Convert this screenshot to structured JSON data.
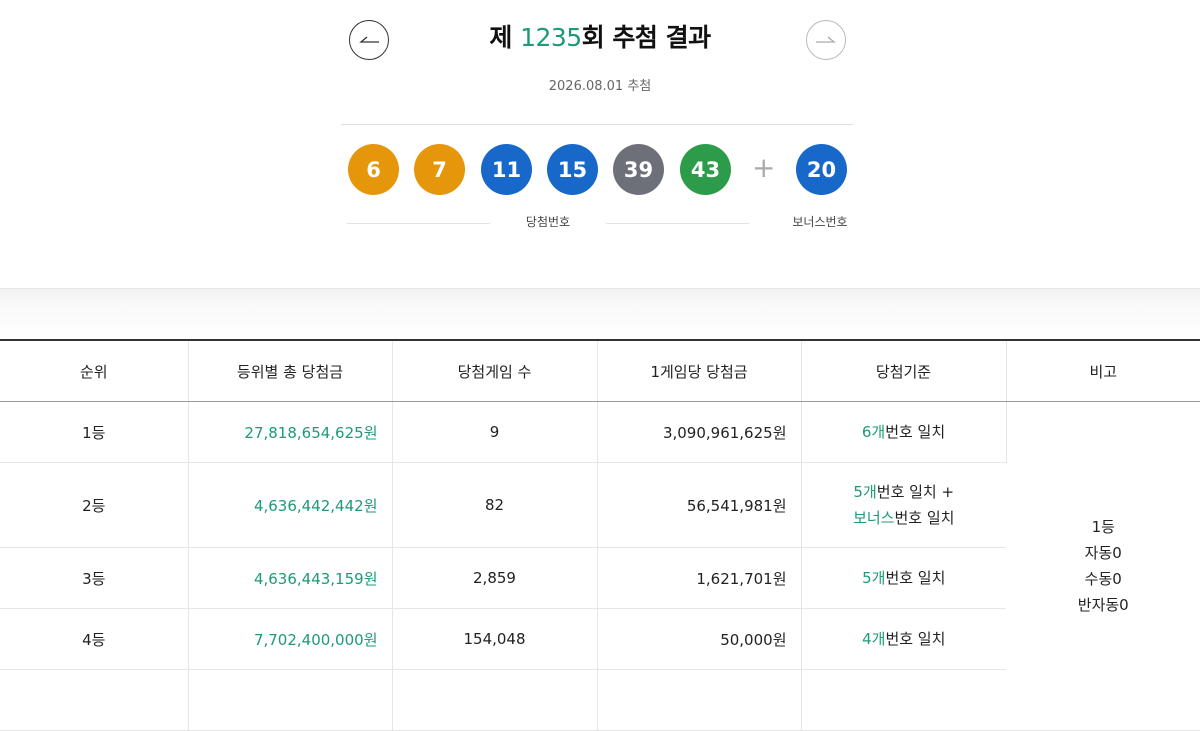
{
  "draw": {
    "title_prefix": "제 ",
    "round": "1235",
    "title_suffix": "회 추첨 결과",
    "date": "2026.08.01 추첨"
  },
  "nav": {
    "prev_icon": "arrow-left-icon",
    "next_icon": "arrow-right-icon"
  },
  "balls": [
    {
      "value": "6",
      "color": "#e6960b"
    },
    {
      "value": "7",
      "color": "#e6960b"
    },
    {
      "value": "11",
      "color": "#1768c9"
    },
    {
      "value": "15",
      "color": "#1768c9"
    },
    {
      "value": "39",
      "color": "#6e7079"
    },
    {
      "value": "43",
      "color": "#2d9c4a"
    }
  ],
  "plus": "+",
  "bonus_ball": {
    "value": "20",
    "color": "#1768c9"
  },
  "labels": {
    "winning": "당첨번호",
    "bonus": "보너스번호"
  },
  "table": {
    "headers": [
      "순위",
      "등위별 총 당첨금",
      "당첨게임 수",
      "1게임당 당첨금",
      "당첨기준",
      "비고"
    ],
    "rows": [
      {
        "rank": "1등",
        "total": "27,818,654,625원",
        "winners": "9",
        "per_game": "3,090,961,625원",
        "criteria": [
          {
            "hl": "6개",
            "text": "번호 일치"
          }
        ]
      },
      {
        "rank": "2등",
        "total": "4,636,442,442원",
        "winners": "82",
        "per_game": "56,541,981원",
        "criteria": [
          {
            "hl": "5개",
            "text": "번호 일치 +"
          },
          {
            "hl": "보너스",
            "text": "번호 일치"
          }
        ]
      },
      {
        "rank": "3등",
        "total": "4,636,443,159원",
        "winners": "2,859",
        "per_game": "1,621,701원",
        "criteria": [
          {
            "hl": "5개",
            "text": "번호 일치"
          }
        ]
      },
      {
        "rank": "4등",
        "total": "7,702,400,000원",
        "winners": "154,048",
        "per_game": "50,000원",
        "criteria": [
          {
            "hl": "4개",
            "text": "번호 일치"
          }
        ]
      }
    ],
    "note": [
      "1등",
      "자동0",
      "수동0",
      "반자동0"
    ]
  }
}
